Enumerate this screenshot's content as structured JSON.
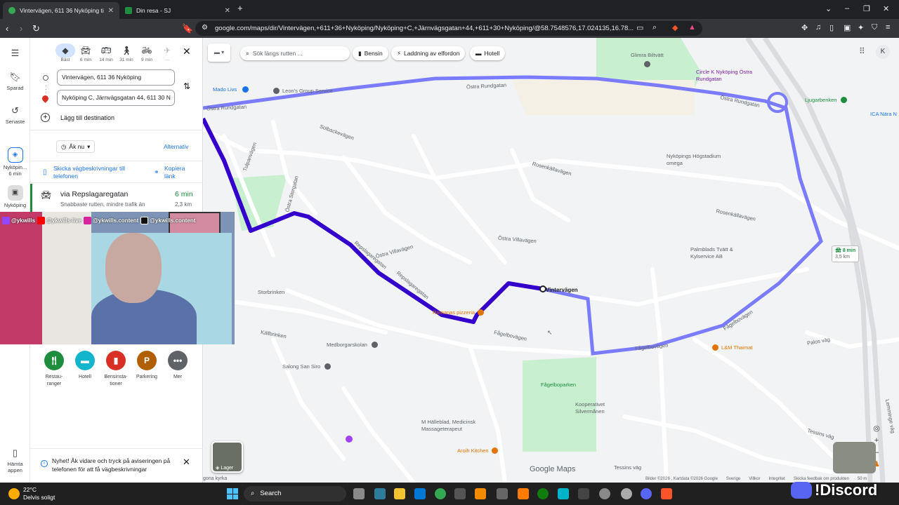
{
  "browser": {
    "tabs": [
      {
        "title": "Vintervägen, 611 36 Nyköping ti",
        "active": true,
        "favicon_color": "#34a853"
      },
      {
        "title": "Din resa - SJ",
        "active": false,
        "favicon_color": "#1e8e3e"
      }
    ],
    "url": "google.com/maps/dir/Vintervägen,+611+36+Nyköping/Nyköping+C,+Järnvägsgatan+44,+611+30+Nyköping/@58.7548576,17.024135,16.78..."
  },
  "rail": {
    "saved": "Sparad",
    "recent": "Senaste",
    "trip1": "Nyköpin...",
    "trip1_time": "6 min",
    "trip2": "Nyköping",
    "download": "Hämta appen"
  },
  "directions": {
    "modes": [
      {
        "label": "Bäst",
        "icon": "directions-icon"
      },
      {
        "label": "6 min",
        "icon": "car-icon"
      },
      {
        "label": "14 min",
        "icon": "transit-icon"
      },
      {
        "label": "31 min",
        "icon": "walk-icon"
      },
      {
        "label": "9 min",
        "icon": "bike-icon"
      },
      {
        "label": "—",
        "icon": "plane-icon"
      }
    ],
    "origin": "Vintervägen, 611 36 Nyköping",
    "destination": "Nyköping C, Järnvägsgatan 44, 611 30 N",
    "add_destination": "Lägg till destination",
    "depart": "Åk nu",
    "options": "Alternativ",
    "send_to_phone": "Skicka vägbeskrivningar till telefonen",
    "copy_link": "Kopiera länk",
    "route_name": "via Repslagaregatan",
    "route_time": "6 min",
    "route_desc": "Snabbaste rutten, mindre trafik än",
    "route_dist": "2,3 km"
  },
  "nearby": [
    {
      "label": "Restau-\nranger",
      "color": "#1e8e3e",
      "glyph": "🍴"
    },
    {
      "label": "Hotell",
      "color": "#12b5cb",
      "glyph": "▬"
    },
    {
      "label": "Bensinsta-\ntioner",
      "color": "#d93025",
      "glyph": "▮"
    },
    {
      "label": "Parkering",
      "color": "#b06000",
      "glyph": "P"
    },
    {
      "label": "Mer",
      "color": "#5f6368",
      "glyph": "•••"
    }
  ],
  "notice": "Nyhet! Åk vidare och tryck på aviseringen på telefonen för att få vägbeskrivningar",
  "map": {
    "search_placeholder": "Sök längs rutten ...",
    "chips": [
      "Bensin",
      "Laddning av elfordon",
      "Hotell"
    ],
    "avatar": "K",
    "layers": "Lager",
    "alt_route_time": "8 min",
    "alt_route_dist": "3,5 km",
    "brand": "Google Maps",
    "footer": [
      "Bilder ©2026 , Kartdata ©2026 Google",
      "Sverige",
      "Villkor",
      "Integritet",
      "Skicka feedbak om produkten",
      "50 m"
    ],
    "streets": [
      "Östra Rundgatan",
      "Östra Rundgatan",
      "Östra Rundgatan",
      "Solbackevägen",
      "Tulpanvägen",
      "Östra Storgatan",
      "Rosenkällavägen",
      "Rosenkällavägen",
      "Östra Villavägen",
      "Östra Villavägen",
      "Fågelbovägen",
      "Fågelbovägen",
      "Fågelbovägen",
      "Vintervägen",
      "Repslagaregatan",
      "Repslagaregatan",
      "Storbrinken",
      "Källbrinken",
      "Lemminge väg",
      "Palos väg",
      "Tessins väg",
      "Tessins väg"
    ],
    "pois": [
      {
        "name": "Glimra Biltvätt",
        "color": "#5f6368"
      },
      {
        "name": "Circle K Nyköping Östra Rundgatan",
        "color": "#7b1fa2"
      },
      {
        "name": "Mado Livs",
        "color": "#1a73e8"
      },
      {
        "name": "Leon's Group Service",
        "color": "#5f6368"
      },
      {
        "name": "Ljugarbenken",
        "color": "#1e8e3e"
      },
      {
        "name": "ICA Nära N",
        "color": "#1a73e8"
      },
      {
        "name": "Nyköpings Högstadium omega",
        "color": "#5f6368"
      },
      {
        "name": "Palmblads Tvätt & Kylservice AB",
        "color": "#5f6368"
      },
      {
        "name": "Romanas pizzeria",
        "color": "#e37400"
      },
      {
        "name": "Medborgarskolan",
        "color": "#5f6368"
      },
      {
        "name": "Salong San Siro",
        "color": "#5f6368"
      },
      {
        "name": "L&M Thaimat",
        "color": "#e37400"
      },
      {
        "name": "Fågelboparken",
        "color": "#1e8e3e"
      },
      {
        "name": "Kooperativet Silvermånen",
        "color": "#5f6368"
      },
      {
        "name": "M Hälleblad, Medicinsk Massageterapeut",
        "color": "#5f6368"
      },
      {
        "name": "Aroih Kitchen",
        "color": "#e37400"
      }
    ],
    "route_point": "Vintervägen",
    "bottom_text": "gona kyrka"
  },
  "stream": {
    "handle1": "@ykwills",
    "handle2": "@ykwills-live",
    "handle3": "@ykwills.content",
    "handle4": "@ykwills.content",
    "discord": "!Discord"
  },
  "taskbar": {
    "weather_temp": "22°C",
    "weather_desc": "Delvis soligt",
    "search": "Search"
  },
  "colors": {
    "route": "#3300cc",
    "route_alt": "#7b7bff",
    "park": "#c8efcf",
    "accent": "#1a73e8"
  }
}
